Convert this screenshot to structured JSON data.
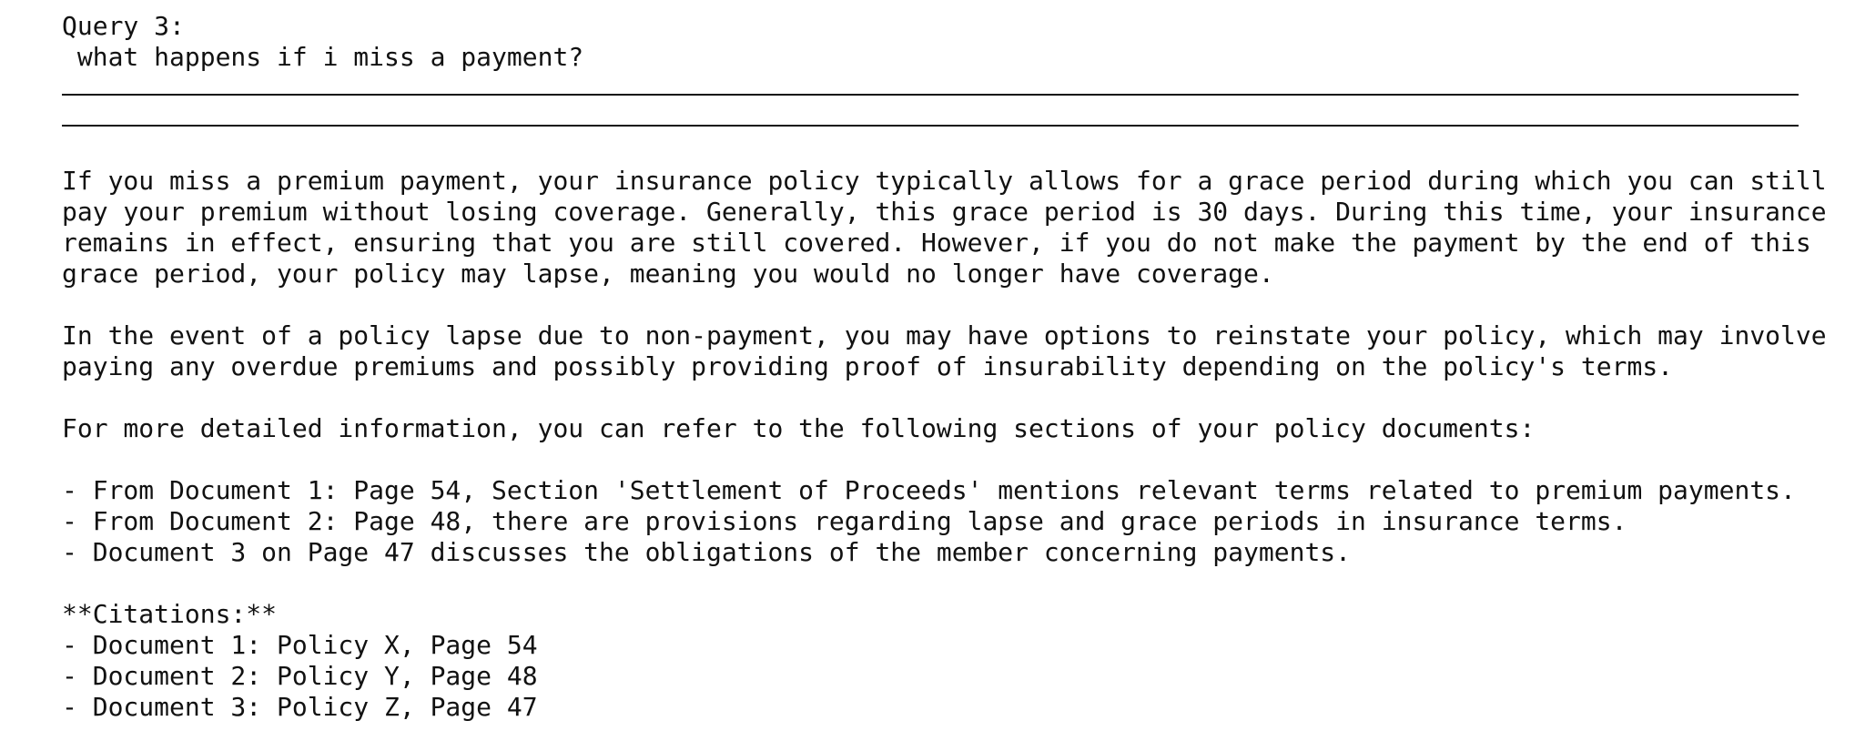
{
  "query": {
    "label": "Query 3:",
    "text": " what happens if i miss a payment?"
  },
  "answer": {
    "paragraph1": [
      "If you miss a premium payment, your insurance policy typically allows for a grace period during which you can still",
      "pay your premium without losing coverage. Generally, this grace period is 30 days. During this time, your insurance",
      "remains in effect, ensuring that you are still covered. However, if you do not make the payment by the end of this",
      "grace period, your policy may lapse, meaning you would no longer have coverage."
    ],
    "paragraph2": [
      "In the event of a policy lapse due to non-payment, you may have options to reinstate your policy, which may involve",
      "paying any overdue premiums and possibly providing proof of insurability depending on the policy's terms."
    ],
    "paragraph3": "For more detailed information, you can refer to the following sections of your policy documents:",
    "references": [
      "- From Document 1: Page 54, Section 'Settlement of Proceeds' mentions relevant terms related to premium payments.",
      "- From Document 2: Page 48, there are provisions regarding lapse and grace periods in insurance terms.",
      "- Document 3 on Page 47 discusses the obligations of the member concerning payments."
    ],
    "citations_heading": "**Citations:**",
    "citations": [
      "- Document 1: Policy X, Page 54",
      "- Document 2: Policy Y, Page 48",
      "- Document 3: Policy Z, Page 47"
    ]
  }
}
